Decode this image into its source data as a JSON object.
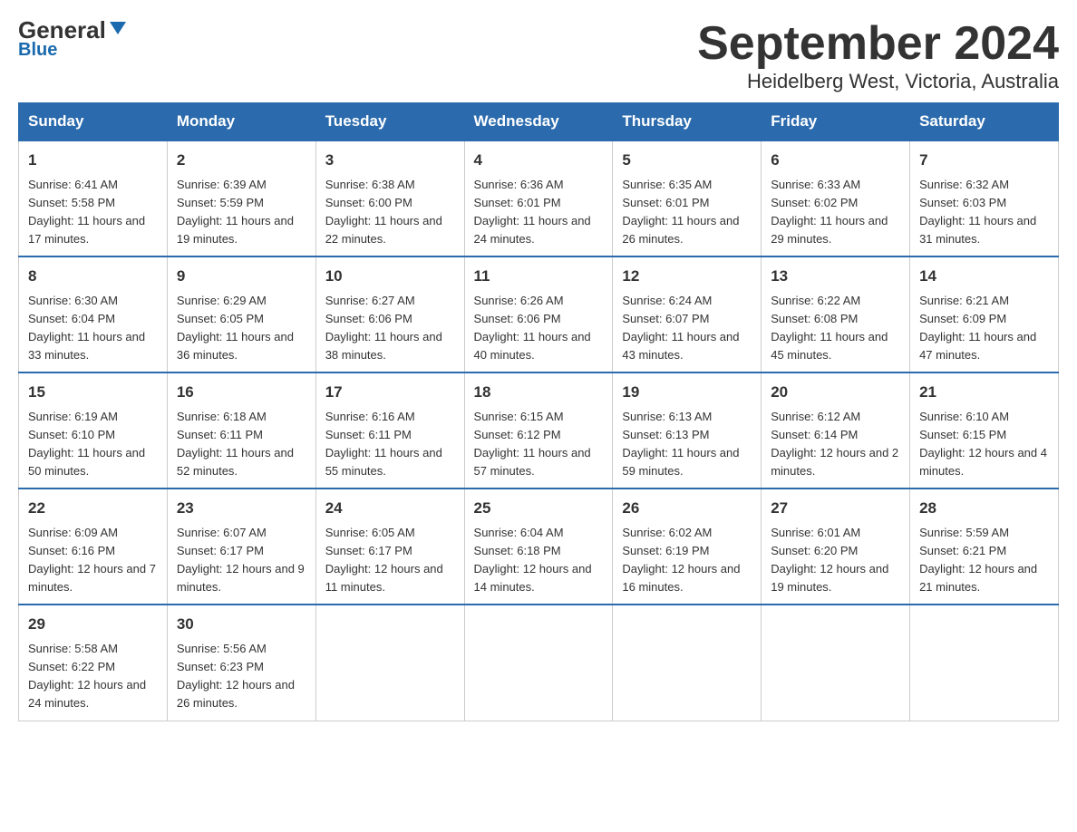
{
  "logo": {
    "text_general": "General",
    "text_blue": "Blue"
  },
  "title": "September 2024",
  "location": "Heidelberg West, Victoria, Australia",
  "headers": [
    "Sunday",
    "Monday",
    "Tuesday",
    "Wednesday",
    "Thursday",
    "Friday",
    "Saturday"
  ],
  "weeks": [
    [
      {
        "day": "1",
        "sunrise": "6:41 AM",
        "sunset": "5:58 PM",
        "daylight": "11 hours and 17 minutes."
      },
      {
        "day": "2",
        "sunrise": "6:39 AM",
        "sunset": "5:59 PM",
        "daylight": "11 hours and 19 minutes."
      },
      {
        "day": "3",
        "sunrise": "6:38 AM",
        "sunset": "6:00 PM",
        "daylight": "11 hours and 22 minutes."
      },
      {
        "day": "4",
        "sunrise": "6:36 AM",
        "sunset": "6:01 PM",
        "daylight": "11 hours and 24 minutes."
      },
      {
        "day": "5",
        "sunrise": "6:35 AM",
        "sunset": "6:01 PM",
        "daylight": "11 hours and 26 minutes."
      },
      {
        "day": "6",
        "sunrise": "6:33 AM",
        "sunset": "6:02 PM",
        "daylight": "11 hours and 29 minutes."
      },
      {
        "day": "7",
        "sunrise": "6:32 AM",
        "sunset": "6:03 PM",
        "daylight": "11 hours and 31 minutes."
      }
    ],
    [
      {
        "day": "8",
        "sunrise": "6:30 AM",
        "sunset": "6:04 PM",
        "daylight": "11 hours and 33 minutes."
      },
      {
        "day": "9",
        "sunrise": "6:29 AM",
        "sunset": "6:05 PM",
        "daylight": "11 hours and 36 minutes."
      },
      {
        "day": "10",
        "sunrise": "6:27 AM",
        "sunset": "6:06 PM",
        "daylight": "11 hours and 38 minutes."
      },
      {
        "day": "11",
        "sunrise": "6:26 AM",
        "sunset": "6:06 PM",
        "daylight": "11 hours and 40 minutes."
      },
      {
        "day": "12",
        "sunrise": "6:24 AM",
        "sunset": "6:07 PM",
        "daylight": "11 hours and 43 minutes."
      },
      {
        "day": "13",
        "sunrise": "6:22 AM",
        "sunset": "6:08 PM",
        "daylight": "11 hours and 45 minutes."
      },
      {
        "day": "14",
        "sunrise": "6:21 AM",
        "sunset": "6:09 PM",
        "daylight": "11 hours and 47 minutes."
      }
    ],
    [
      {
        "day": "15",
        "sunrise": "6:19 AM",
        "sunset": "6:10 PM",
        "daylight": "11 hours and 50 minutes."
      },
      {
        "day": "16",
        "sunrise": "6:18 AM",
        "sunset": "6:11 PM",
        "daylight": "11 hours and 52 minutes."
      },
      {
        "day": "17",
        "sunrise": "6:16 AM",
        "sunset": "6:11 PM",
        "daylight": "11 hours and 55 minutes."
      },
      {
        "day": "18",
        "sunrise": "6:15 AM",
        "sunset": "6:12 PM",
        "daylight": "11 hours and 57 minutes."
      },
      {
        "day": "19",
        "sunrise": "6:13 AM",
        "sunset": "6:13 PM",
        "daylight": "11 hours and 59 minutes."
      },
      {
        "day": "20",
        "sunrise": "6:12 AM",
        "sunset": "6:14 PM",
        "daylight": "12 hours and 2 minutes."
      },
      {
        "day": "21",
        "sunrise": "6:10 AM",
        "sunset": "6:15 PM",
        "daylight": "12 hours and 4 minutes."
      }
    ],
    [
      {
        "day": "22",
        "sunrise": "6:09 AM",
        "sunset": "6:16 PM",
        "daylight": "12 hours and 7 minutes."
      },
      {
        "day": "23",
        "sunrise": "6:07 AM",
        "sunset": "6:17 PM",
        "daylight": "12 hours and 9 minutes."
      },
      {
        "day": "24",
        "sunrise": "6:05 AM",
        "sunset": "6:17 PM",
        "daylight": "12 hours and 11 minutes."
      },
      {
        "day": "25",
        "sunrise": "6:04 AM",
        "sunset": "6:18 PM",
        "daylight": "12 hours and 14 minutes."
      },
      {
        "day": "26",
        "sunrise": "6:02 AM",
        "sunset": "6:19 PM",
        "daylight": "12 hours and 16 minutes."
      },
      {
        "day": "27",
        "sunrise": "6:01 AM",
        "sunset": "6:20 PM",
        "daylight": "12 hours and 19 minutes."
      },
      {
        "day": "28",
        "sunrise": "5:59 AM",
        "sunset": "6:21 PM",
        "daylight": "12 hours and 21 minutes."
      }
    ],
    [
      {
        "day": "29",
        "sunrise": "5:58 AM",
        "sunset": "6:22 PM",
        "daylight": "12 hours and 24 minutes."
      },
      {
        "day": "30",
        "sunrise": "5:56 AM",
        "sunset": "6:23 PM",
        "daylight": "12 hours and 26 minutes."
      },
      null,
      null,
      null,
      null,
      null
    ]
  ]
}
